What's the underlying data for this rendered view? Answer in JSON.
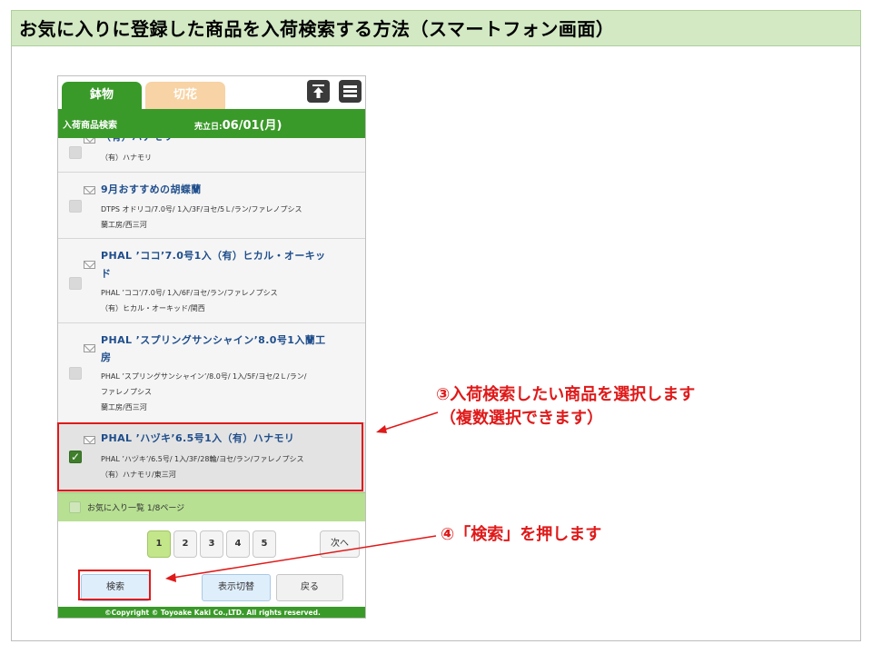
{
  "slide": {
    "title": "お気に入りに登録した商品を入荷検索する方法（スマートフォン画面）"
  },
  "app": {
    "tabs": [
      {
        "label": "鉢物",
        "active": true
      },
      {
        "label": "切花",
        "active": false
      }
    ],
    "icons": {
      "scroll_top": "arrow-up-bar-icon",
      "menu": "hamburger-icon"
    },
    "header": {
      "title": "入荷商品検索",
      "date_label": "売立日:",
      "date_value": "06/01(月)"
    },
    "items": [
      {
        "title_lines": [
          "（有）ハナモリ"
        ],
        "details": [
          "（有）ハナモリ"
        ],
        "checked": false
      },
      {
        "title_lines": [
          "9月おすすめの胡蝶蘭"
        ],
        "details": [
          "DTPS オドリコ/7.0号/ 1入/3F/ヨセ/5Ｌ/ラン/ファレノプシス",
          "蘭工房/西三河"
        ],
        "checked": false
      },
      {
        "title_lines": [
          "PHAL ’ココ’7.0号1入（有）ヒカル・オーキッ",
          "ド"
        ],
        "details": [
          "PHAL ’ココ’/7.0号/ 1入/6F/ヨセ/ラン/ファレノプシス",
          "（有）ヒカル・オーキッド/関西"
        ],
        "checked": false
      },
      {
        "title_lines": [
          "PHAL ’スプリングサンシャイン’8.0号1入蘭工",
          "房"
        ],
        "details": [
          "PHAL ’スプリングサンシャイン’/8.0号/ 1入/5F/ヨセ/2Ｌ/ラン/",
          "ファレノプシス",
          "蘭工房/西三河"
        ],
        "checked": false
      },
      {
        "title_lines": [
          "PHAL ’ハヅキ’6.5号1入（有）ハナモリ"
        ],
        "details": [
          "PHAL ’ハヅキ’/6.5号/ 1入/3F/28輪/ヨセ/ラン/ファレノプシス",
          "（有）ハナモリ/東三河"
        ],
        "checked": true
      }
    ],
    "pager": {
      "label": "お気に入り一覧 1/8ページ",
      "pages": [
        "1",
        "2",
        "3",
        "4",
        "5"
      ],
      "current_page": "1",
      "next_label": "次へ"
    },
    "actions": {
      "search": "検索",
      "toggle": "表示切替",
      "back": "戻る"
    },
    "footer": "©Copyright © Toyoake Kaki Co.,LTD. All rights reserved."
  },
  "annotations": {
    "callout_select_line1": "③入荷検索したい商品を選択します",
    "callout_select_line2": "（複数選択できます）",
    "callout_search": "④「検索」を押します",
    "highlight_color": "#e01919"
  }
}
